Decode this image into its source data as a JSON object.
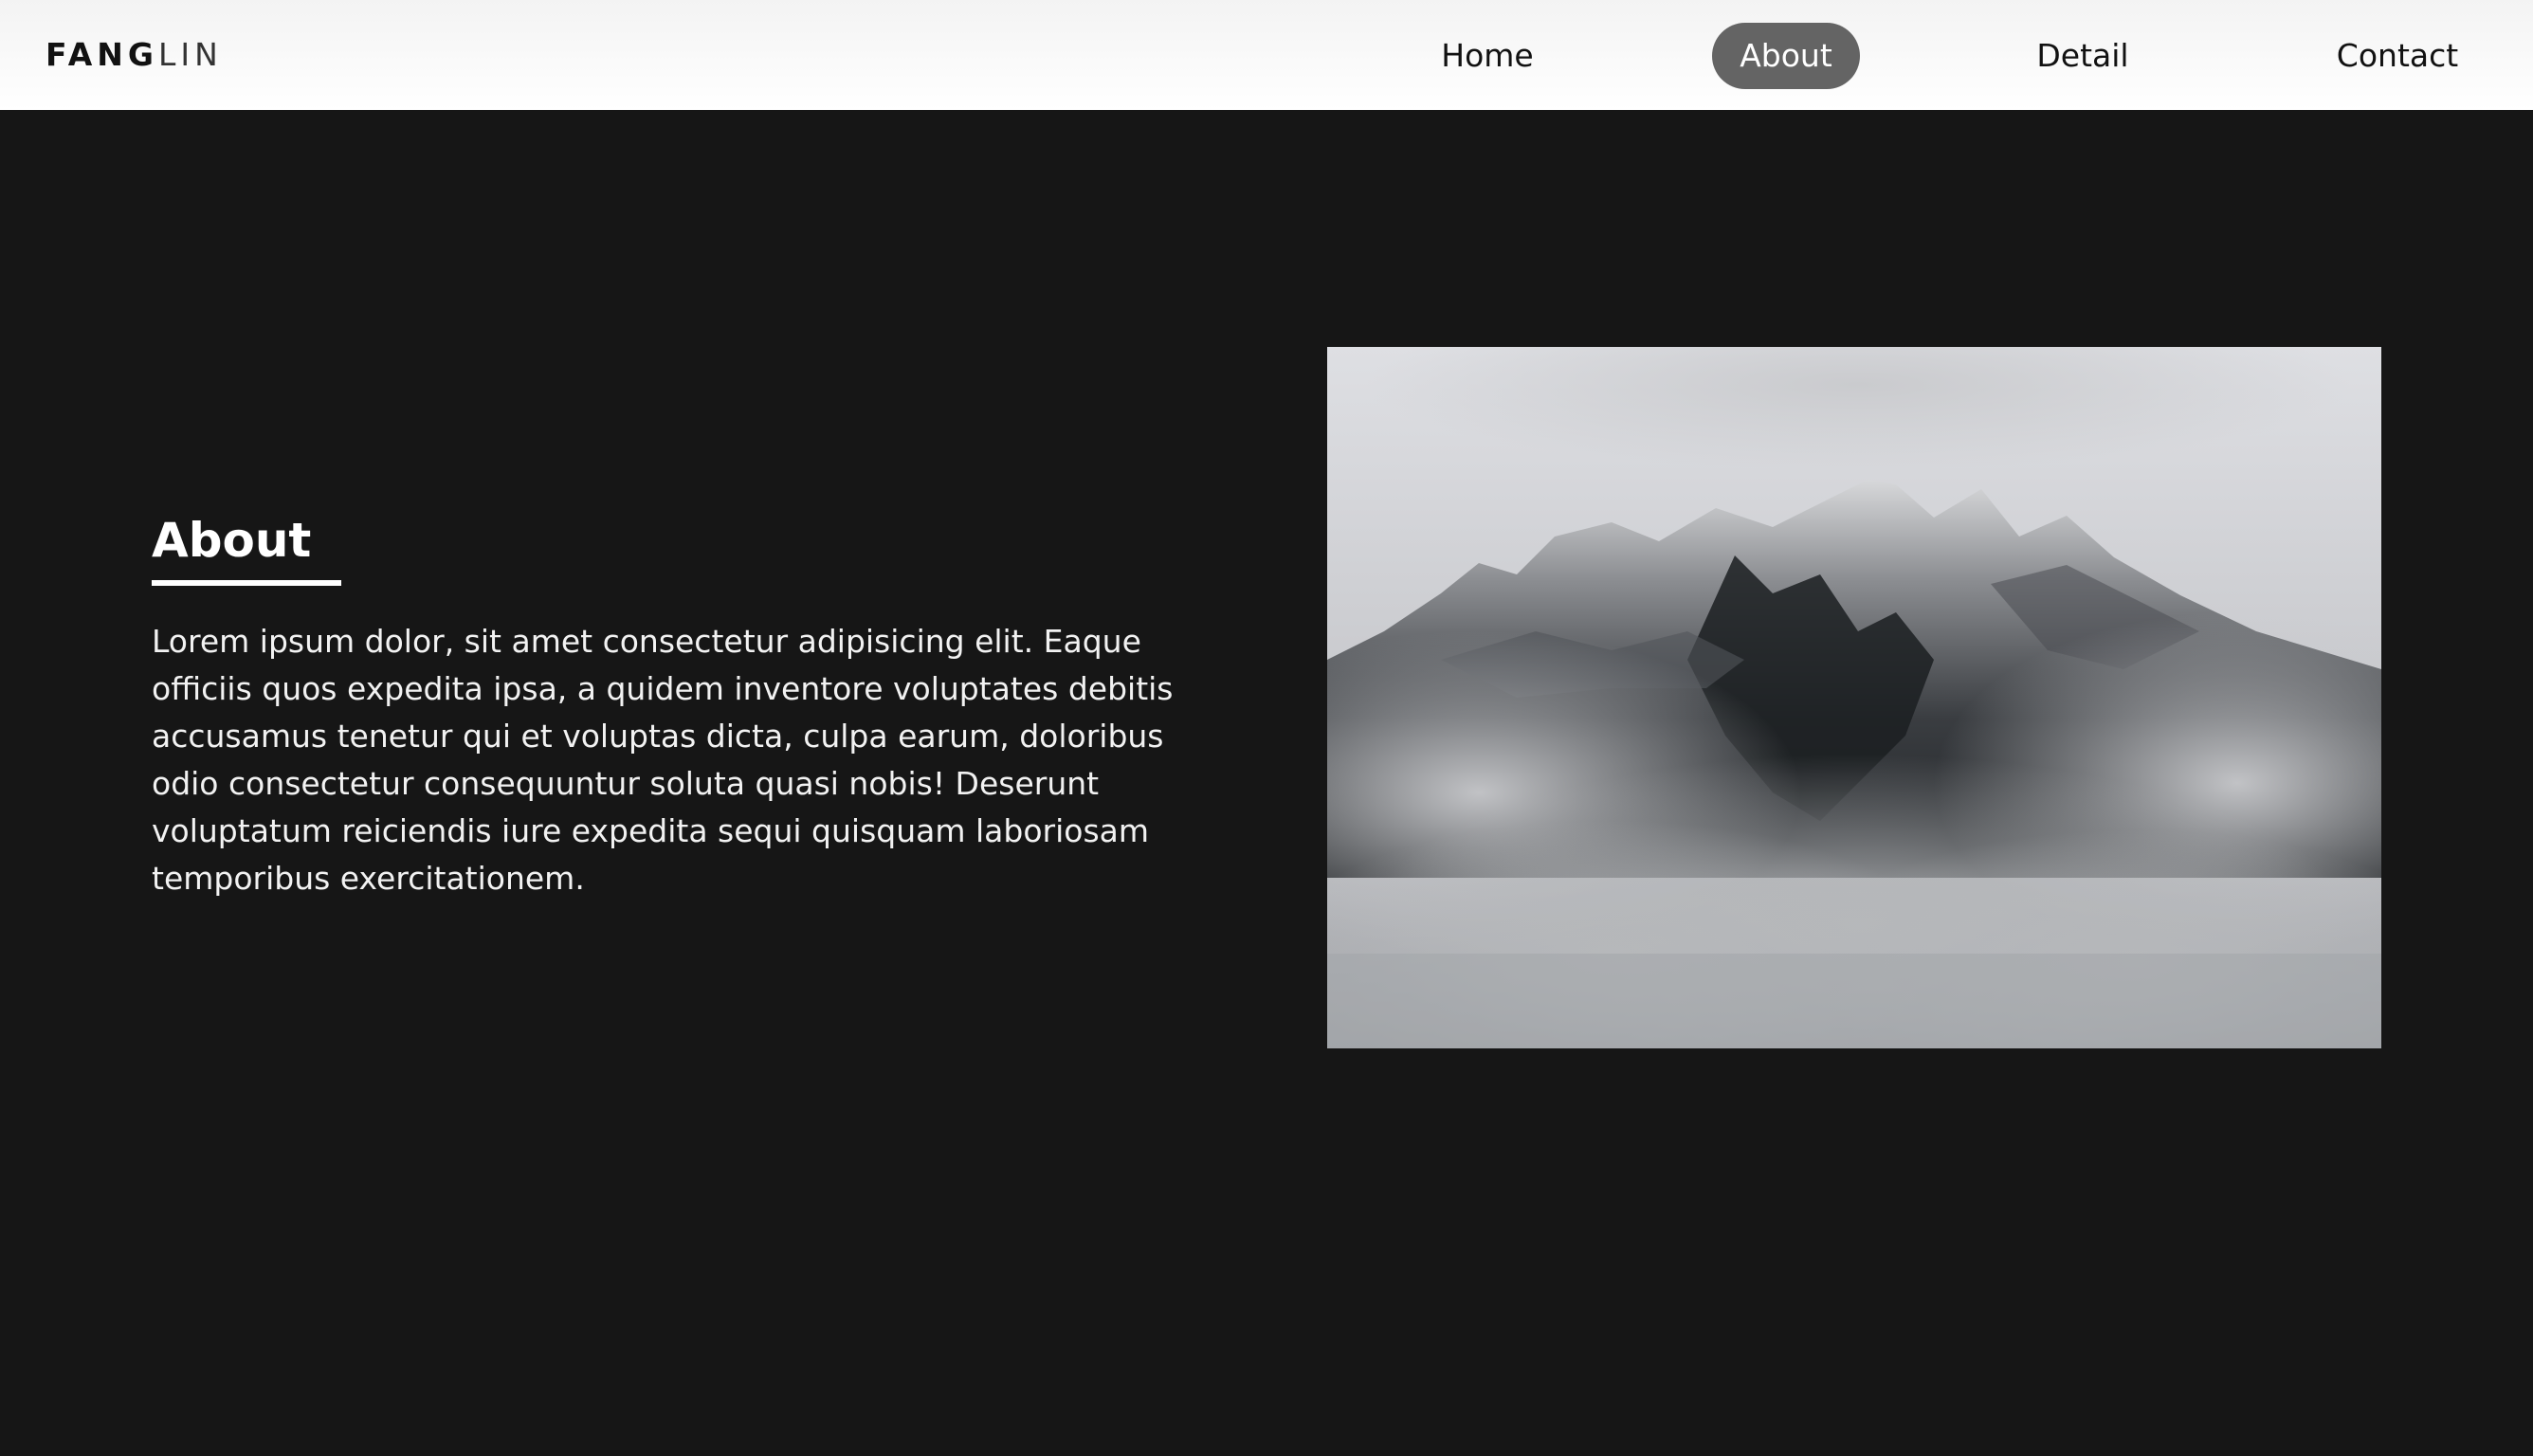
{
  "header": {
    "logo_strong": "FANG",
    "logo_light": "LIN",
    "nav": {
      "home": "Home",
      "about": "About",
      "detail": "Detail",
      "contact": "Contact"
    },
    "active_nav": "about"
  },
  "about": {
    "title": "About",
    "body": "Lorem ipsum dolor, sit amet consectetur adipisicing elit. Eaque officiis quos expedita ipsa, a quidem inventore voluptates debitis accusamus tenetur qui et voluptas dicta, culpa earum, doloribus odio consectetur consequuntur soluta quasi nobis! Deserunt voluptatum reiciendis iure expedita sequi quisquam laboriosam temporibus exercitationem."
  },
  "colors": {
    "background": "#161616",
    "nav_background": "#ffffff",
    "active_pill": "#646464",
    "text_light": "#ffffff"
  }
}
